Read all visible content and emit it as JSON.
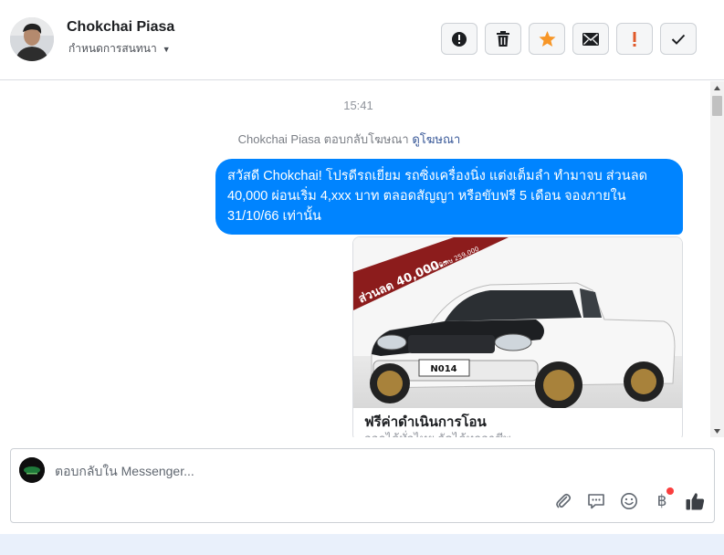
{
  "header": {
    "contact_name": "Chokchai Piasa",
    "conversation_settings_label": "กำหนดการสนทนา",
    "actions": [
      {
        "name": "report-spam-button",
        "icon": "alert-circle-icon"
      },
      {
        "name": "delete-button",
        "icon": "trash-icon"
      },
      {
        "name": "star-button",
        "icon": "star-icon"
      },
      {
        "name": "mark-unread-button",
        "icon": "envelope-icon"
      },
      {
        "name": "follow-up-button",
        "icon": "exclamation-icon"
      },
      {
        "name": "mark-done-button",
        "icon": "check-icon"
      }
    ],
    "colors": {
      "star": "#f79627",
      "followup": "#e0592a"
    }
  },
  "thread": {
    "timestamp": "15:41",
    "ad_reply_text": "Chokchai Piasa ตอบกลับโฆษณา",
    "ad_reply_link": "ดูโฆษณา",
    "message": "สวัสดี Chokchai! โปรดีรถเยี่ยม รถซิ่งเครื่องนิ่ง แต่งเต็มลำ ทำมาจบ ส่วนลด 40,000 ผ่อนเริ่ม 4,xxx บาท ตลอดสัญญา หรือขับฟรี 5 เดือน จองภายใน 31/10/66 เท่านั้น",
    "message_color": "#0084ff",
    "card": {
      "banner_text": "ส่วนลด 40,000.-",
      "banner_small": "ราคาพิเศษ 259,000",
      "plate": "N014",
      "title": "ฟรีค่าดำเนินการโอน",
      "subtitle": "ออกได้ทั่วไทย จัดได้ทุกอาชีพ"
    }
  },
  "composer": {
    "placeholder": "ตอบกลับใน Messenger...",
    "tools": [
      "paperclip-icon",
      "saved-replies-icon",
      "emoji-icon",
      "baht-payment-icon",
      "thumbs-up-icon"
    ],
    "baht_symbol": "฿"
  }
}
